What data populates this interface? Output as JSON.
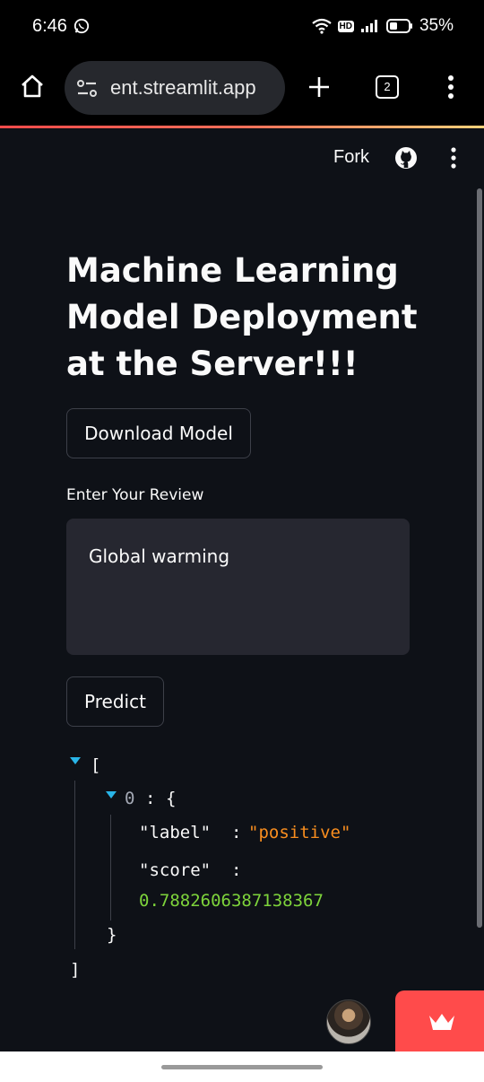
{
  "status_bar": {
    "time": "6:46",
    "hd_label": "HD",
    "battery_percent": "35%"
  },
  "browser": {
    "url": "ent.streamlit.app",
    "tab_count": "2"
  },
  "app_header": {
    "fork_label": "Fork"
  },
  "main": {
    "title": "Machine Learning Model Deployment at the Server!!!",
    "download_button_label": "Download Model",
    "review_label": "Enter Your Review",
    "review_value": "Global warming",
    "predict_button_label": "Predict"
  },
  "json_output": {
    "open_bracket": "[",
    "index_key": "0",
    "colon": ":",
    "open_brace": "{",
    "label_key": "\"label\"",
    "label_value": "\"positive\"",
    "score_key": "\"score\"",
    "score_value": "0.7882606387138367",
    "close_brace": "}",
    "close_bracket": "]"
  },
  "colors": {
    "background": "#0e1117",
    "accent": "#ff4b4b",
    "json_string": "#f98e1f",
    "json_number": "#7ed43b",
    "expander_arrow": "#29b5e8"
  }
}
